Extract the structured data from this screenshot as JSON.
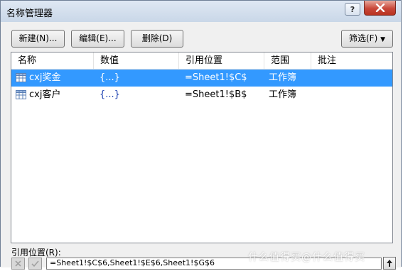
{
  "window": {
    "title": "名称管理器"
  },
  "titlebar": {
    "help_label": "?"
  },
  "toolbar": {
    "new_label": "新建(N)...",
    "edit_label": "编辑(E)...",
    "delete_label": "删除(D)",
    "filter_label": "筛选(F)"
  },
  "columns": [
    "名称",
    "数值",
    "引用位置",
    "范围",
    "批注"
  ],
  "rows": [
    {
      "name": "cxj奖金",
      "value": "{...}",
      "ref": "=Sheet1!$C$",
      "scope": "工作簿",
      "comment": "",
      "selected": true
    },
    {
      "name": "cxj客户",
      "value": "{...}",
      "ref": "=Sheet1!$B$",
      "scope": "工作簿",
      "comment": "",
      "selected": false
    }
  ],
  "ref_section": {
    "label": "引用位置(R):",
    "value": "=Sheet1!$C$6,Sheet1!$E$6,Sheet1!$G$6"
  },
  "watermark": "什么值得买@什么值得买",
  "colors": {
    "selection": "#3399ff",
    "value_text": "#1a3fb0"
  }
}
